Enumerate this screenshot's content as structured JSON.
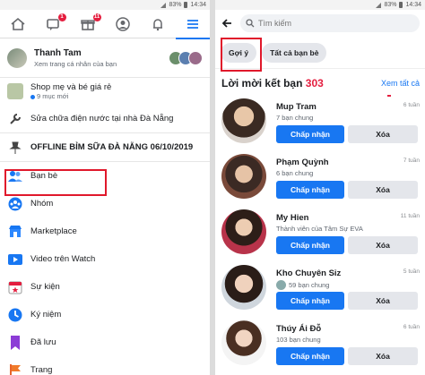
{
  "status": {
    "time": "14:34",
    "battery_left": "83%",
    "battery_right": "83%"
  },
  "left": {
    "nav_badges": {
      "messages": "1",
      "notifications": "11"
    },
    "profile": {
      "name": "Thanh Tam",
      "subtitle": "Xem trang cá nhân của bạn"
    },
    "shortcuts": [
      {
        "label": "Shop mẹ và bé giá rẻ",
        "sub": "9 mục mới"
      },
      {
        "label": "Sửa chữa điện nước tại nhà Đà Nẵng"
      },
      {
        "label": "OFFLINE BỈM SỮA ĐÀ NẴNG 06/10/2019"
      }
    ],
    "menu": [
      "Bạn bè",
      "Nhóm",
      "Marketplace",
      "Video trên Watch",
      "Sự kiện",
      "Ký niệm",
      "Đã lưu",
      "Trang"
    ]
  },
  "right": {
    "search": {
      "placeholder": "Tìm kiếm"
    },
    "chips": [
      "Gợi ý",
      "Tất cả bạn bè"
    ],
    "requests_title": "Lời mời kết bạn",
    "requests_count": "303",
    "see_all": "Xem tất cả",
    "accept_label": "Chấp nhận",
    "delete_label": "Xóa",
    "requests": [
      {
        "name": "Mup Tram",
        "mutual": "7 bạn chung",
        "ago": "6 tuần"
      },
      {
        "name": "Phạm Quỳnh",
        "mutual": "6 bạn chung",
        "ago": "7 tuần"
      },
      {
        "name": "My Hien",
        "mutual": "Thành viên của Tâm Sự EVA",
        "ago": "11 tuần"
      },
      {
        "name": "Kho Chuyên Sỉz",
        "mutual": "59 bạn chung",
        "ago": "5 tuần"
      },
      {
        "name": "Thúy Ái Đỗ",
        "mutual": "103 bạn chung",
        "ago": "6 tuần"
      }
    ]
  }
}
